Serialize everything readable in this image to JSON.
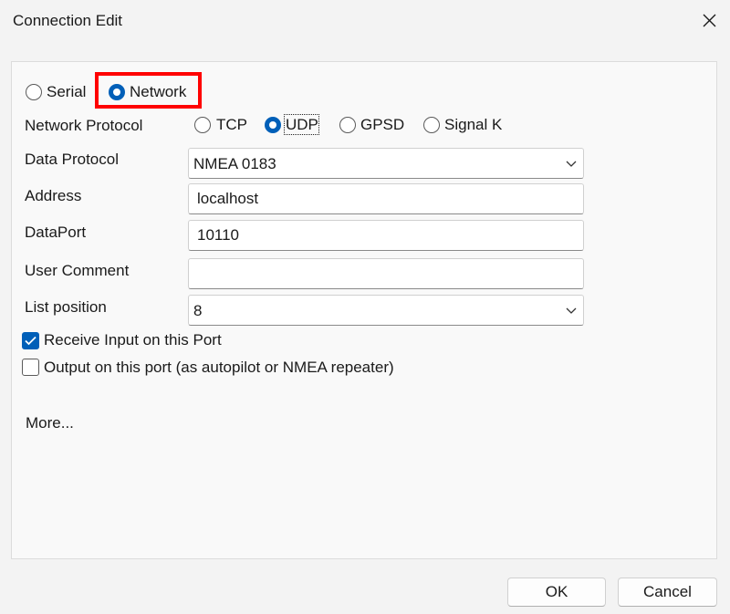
{
  "window": {
    "title": "Connection Edit",
    "close_icon": "close-icon"
  },
  "connection_type": {
    "options": [
      "Serial",
      "Network"
    ],
    "selected": "Network",
    "highlight_color": "#ff0000"
  },
  "network_protocol": {
    "label": "Network Protocol",
    "options": [
      "TCP",
      "UDP",
      "GPSD",
      "Signal K"
    ],
    "selected": "UDP"
  },
  "data_protocol": {
    "label": "Data Protocol",
    "value": "NMEA 0183"
  },
  "address": {
    "label": "Address",
    "value": "localhost"
  },
  "data_port": {
    "label": "DataPort",
    "value": "10110"
  },
  "user_comment": {
    "label": "User Comment",
    "value": ""
  },
  "list_position": {
    "label": "List position",
    "value": "8"
  },
  "receive_input": {
    "label": "Receive Input on this Port",
    "checked": true
  },
  "output_port": {
    "label": "Output on this port (as autopilot or NMEA repeater)",
    "checked": false
  },
  "more": {
    "label": "More..."
  },
  "buttons": {
    "ok": "OK",
    "cancel": "Cancel"
  },
  "colors": {
    "accent": "#005fb8",
    "window_bg": "#f3f3f3"
  }
}
